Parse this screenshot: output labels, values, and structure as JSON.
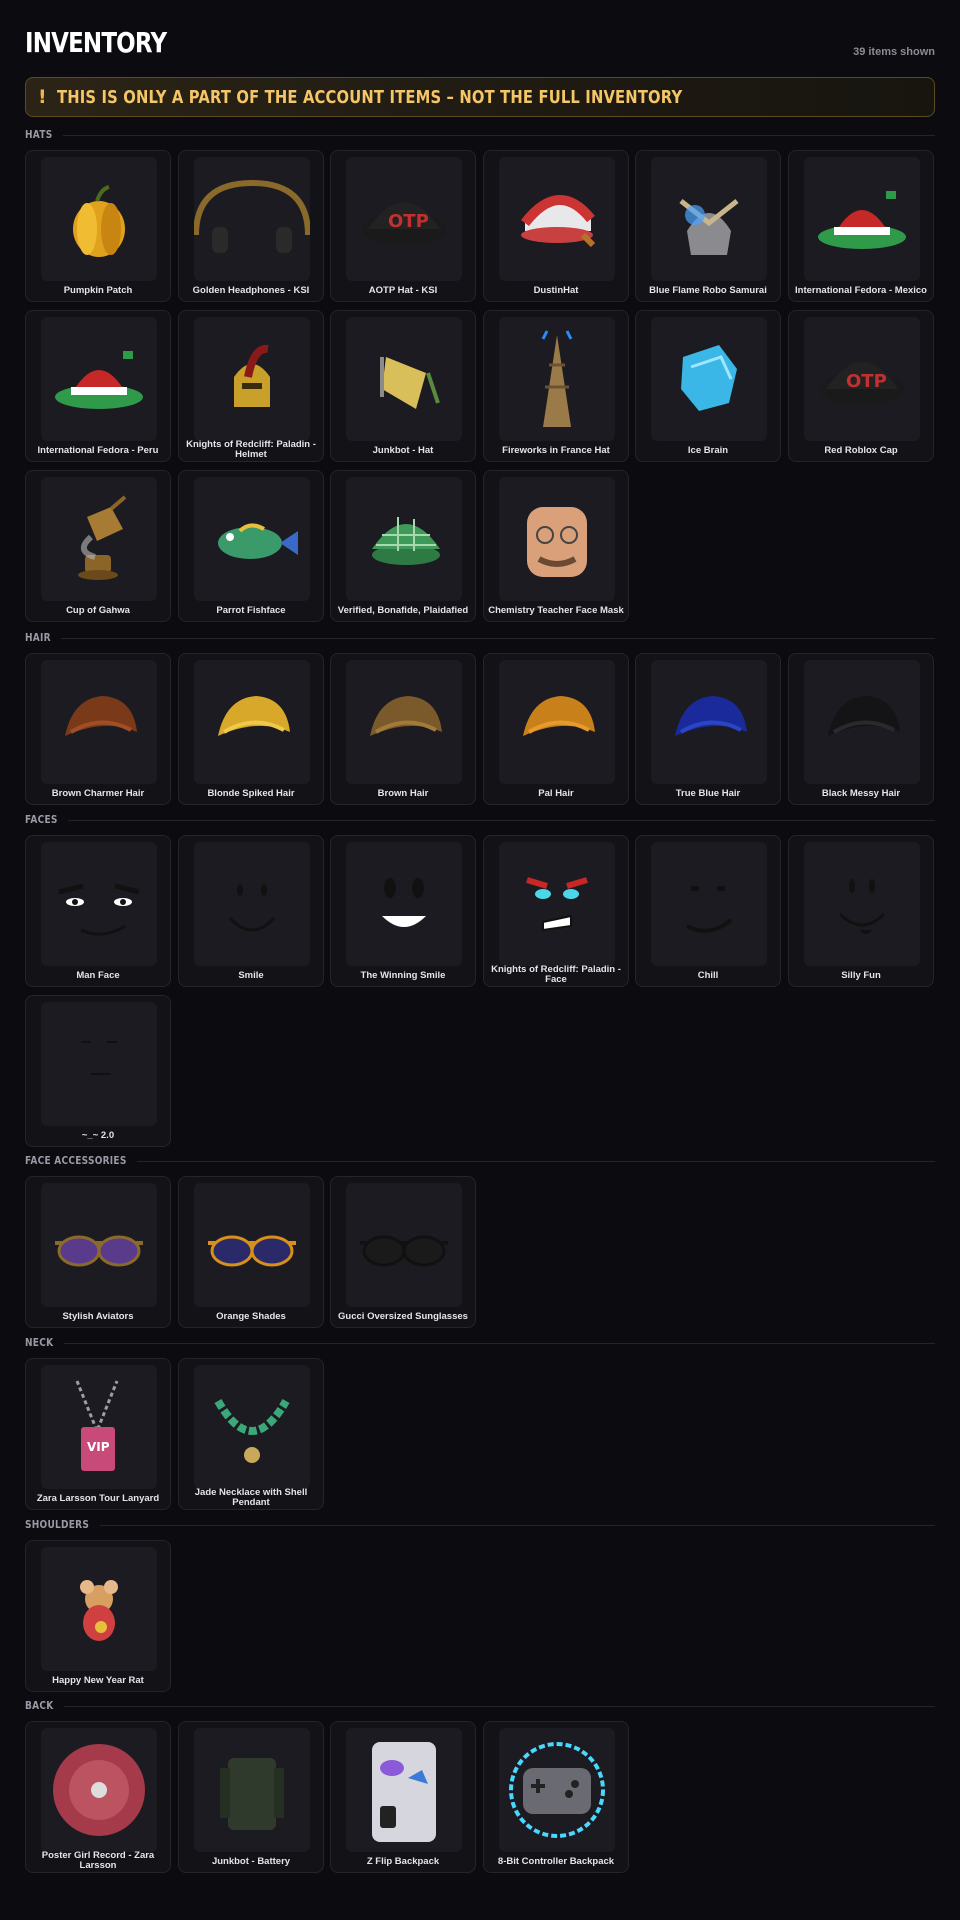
{
  "header": {
    "title": "INVENTORY",
    "count": "39 items shown"
  },
  "banner": {
    "icon": "exclamation-icon",
    "icon_glyph": "!",
    "text": "THIS IS ONLY A PART OF THE ACCOUNT ITEMS – NOT THE FULL INVENTORY",
    "accent": "#f5c668"
  },
  "sections": [
    {
      "title": "HATS",
      "items": [
        {
          "label": "Pumpkin Patch",
          "icon": "pumpkin-icon"
        },
        {
          "label": "Golden Headphones - KSI",
          "icon": "headphones-icon"
        },
        {
          "label": "AOTP Hat - KSI",
          "icon": "cap-icon"
        },
        {
          "label": "DustinHat",
          "icon": "trucker-hat-icon"
        },
        {
          "label": "Blue Flame Robo Samurai",
          "icon": "samurai-helmet-icon"
        },
        {
          "label": "International Fedora - Mexico",
          "icon": "fedora-icon"
        },
        {
          "label": "International Fedora - Peru",
          "icon": "fedora-icon"
        },
        {
          "label": "Knights of Redcliff: Paladin - Helmet",
          "icon": "knight-helmet-icon"
        },
        {
          "label": "Junkbot - Hat",
          "icon": "junkbot-hat-icon"
        },
        {
          "label": "Fireworks in France Hat",
          "icon": "eiffel-tower-icon"
        },
        {
          "label": "Ice Brain",
          "icon": "ice-brain-icon"
        },
        {
          "label": "Red Roblox Cap",
          "icon": "cap-icon"
        },
        {
          "label": "Cup of Gahwa",
          "icon": "coffee-pot-icon"
        },
        {
          "label": "Parrot Fishface",
          "icon": "fish-icon"
        },
        {
          "label": "Verified, Bonafide, Plaidafied",
          "icon": "plaid-cap-icon"
        },
        {
          "label": "Chemistry Teacher Face Mask",
          "icon": "face-mask-icon"
        }
      ]
    },
    {
      "title": "HAIR",
      "items": [
        {
          "label": "Brown Charmer Hair",
          "icon": "hair-icon"
        },
        {
          "label": "Blonde Spiked Hair",
          "icon": "hair-icon"
        },
        {
          "label": "Brown Hair",
          "icon": "hair-icon"
        },
        {
          "label": "Pal Hair",
          "icon": "hair-icon"
        },
        {
          "label": "True Blue Hair",
          "icon": "hair-icon"
        },
        {
          "label": "Black Messy Hair",
          "icon": "hair-icon"
        }
      ]
    },
    {
      "title": "FACES",
      "items": [
        {
          "label": "Man Face",
          "icon": "face-icon"
        },
        {
          "label": "Smile",
          "icon": "face-icon"
        },
        {
          "label": "The Winning Smile",
          "icon": "face-icon"
        },
        {
          "label": "Knights of Redcliff: Paladin - Face",
          "icon": "face-icon"
        },
        {
          "label": "Chill",
          "icon": "face-icon"
        },
        {
          "label": "Silly Fun",
          "icon": "face-icon"
        },
        {
          "label": "~_~ 2.0",
          "icon": "face-icon"
        }
      ]
    },
    {
      "title": "FACE ACCESSORIES",
      "items": [
        {
          "label": "Stylish Aviators",
          "icon": "sunglasses-icon"
        },
        {
          "label": "Orange Shades",
          "icon": "sunglasses-icon"
        },
        {
          "label": "Gucci Oversized Sunglasses",
          "icon": "sunglasses-icon"
        }
      ]
    },
    {
      "title": "NECK",
      "items": [
        {
          "label": "Zara Larsson Tour Lanyard",
          "icon": "lanyard-icon"
        },
        {
          "label": "Jade Necklace with Shell Pendant",
          "icon": "necklace-icon"
        }
      ]
    },
    {
      "title": "SHOULDERS",
      "items": [
        {
          "label": "Happy New Year Rat",
          "icon": "rat-icon"
        }
      ]
    },
    {
      "title": "BACK",
      "items": [
        {
          "label": "Poster Girl Record - Zara Larsson",
          "icon": "record-icon"
        },
        {
          "label": "Junkbot - Battery",
          "icon": "battery-icon"
        },
        {
          "label": "Z Flip Backpack",
          "icon": "phone-backpack-icon"
        },
        {
          "label": "8-Bit Controller Backpack",
          "icon": "controller-icon"
        }
      ]
    }
  ]
}
